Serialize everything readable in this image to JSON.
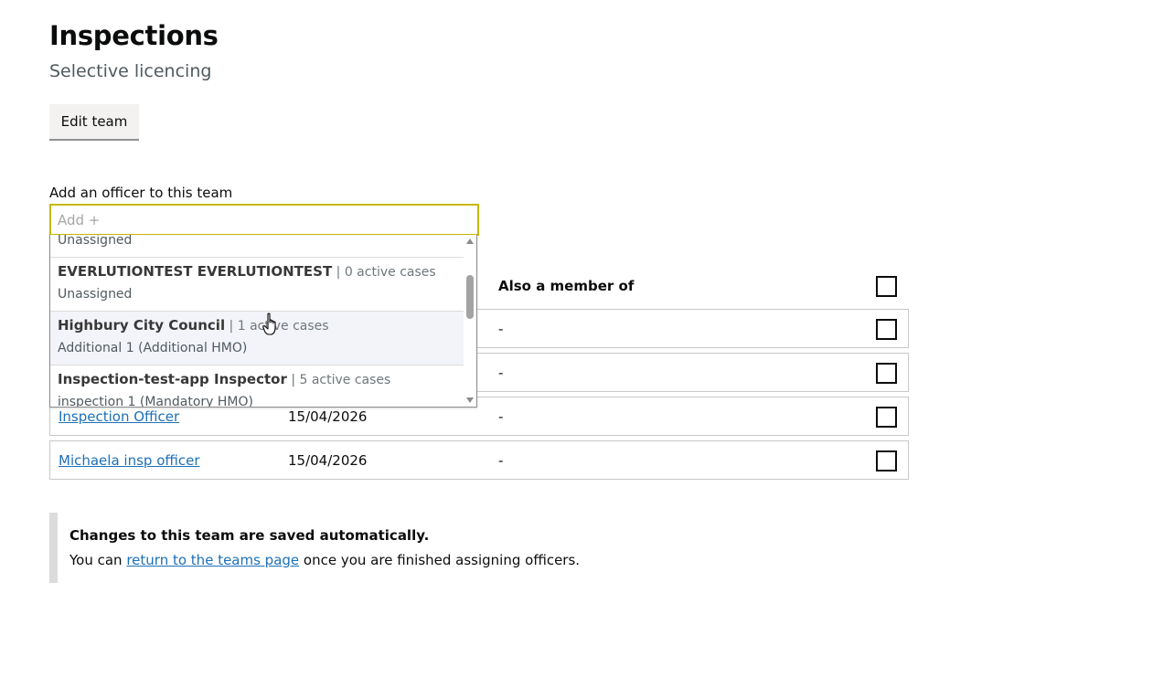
{
  "header": {
    "title": "Inspections",
    "subtitle": "Selective licencing",
    "edit_button": "Edit team"
  },
  "add_officer": {
    "label": "Add an officer to this team",
    "placeholder": "Add +"
  },
  "dropdown": {
    "partial_top_sub": "Unassigned",
    "options": [
      {
        "name": "EVERLUTIONTEST EVERLUTIONTEST",
        "count": "0 active cases",
        "sub": "Unassigned"
      },
      {
        "name": "Highbury City Council",
        "count": "1 active cases",
        "sub": "Additional 1 (Additional HMO)"
      },
      {
        "name": "Inspection-test-app Inspector",
        "count": "5 active cases",
        "sub": "inspection 1 (Mandatory HMO)"
      }
    ]
  },
  "table": {
    "col_also_member": "Also a member of",
    "rows": [
      {
        "name": "",
        "date": "",
        "also": "-"
      },
      {
        "name": "",
        "date": "",
        "also": "-"
      },
      {
        "name": "Inspection Officer",
        "date": "15/04/2026",
        "also": "-"
      },
      {
        "name": "Michaela insp officer",
        "date": "15/04/2026",
        "also": "-"
      }
    ]
  },
  "inset": {
    "strong": "Changes to this team are saved automatically.",
    "text_before": "You can ",
    "link": "return to the teams page",
    "text_after": " once you are finished assigning officers."
  },
  "colors": {
    "link": "#1d70b8",
    "focus": "#c8b800",
    "text": "#0b0c0c"
  },
  "icons": {
    "cursor": "hand-pointer-icon"
  }
}
